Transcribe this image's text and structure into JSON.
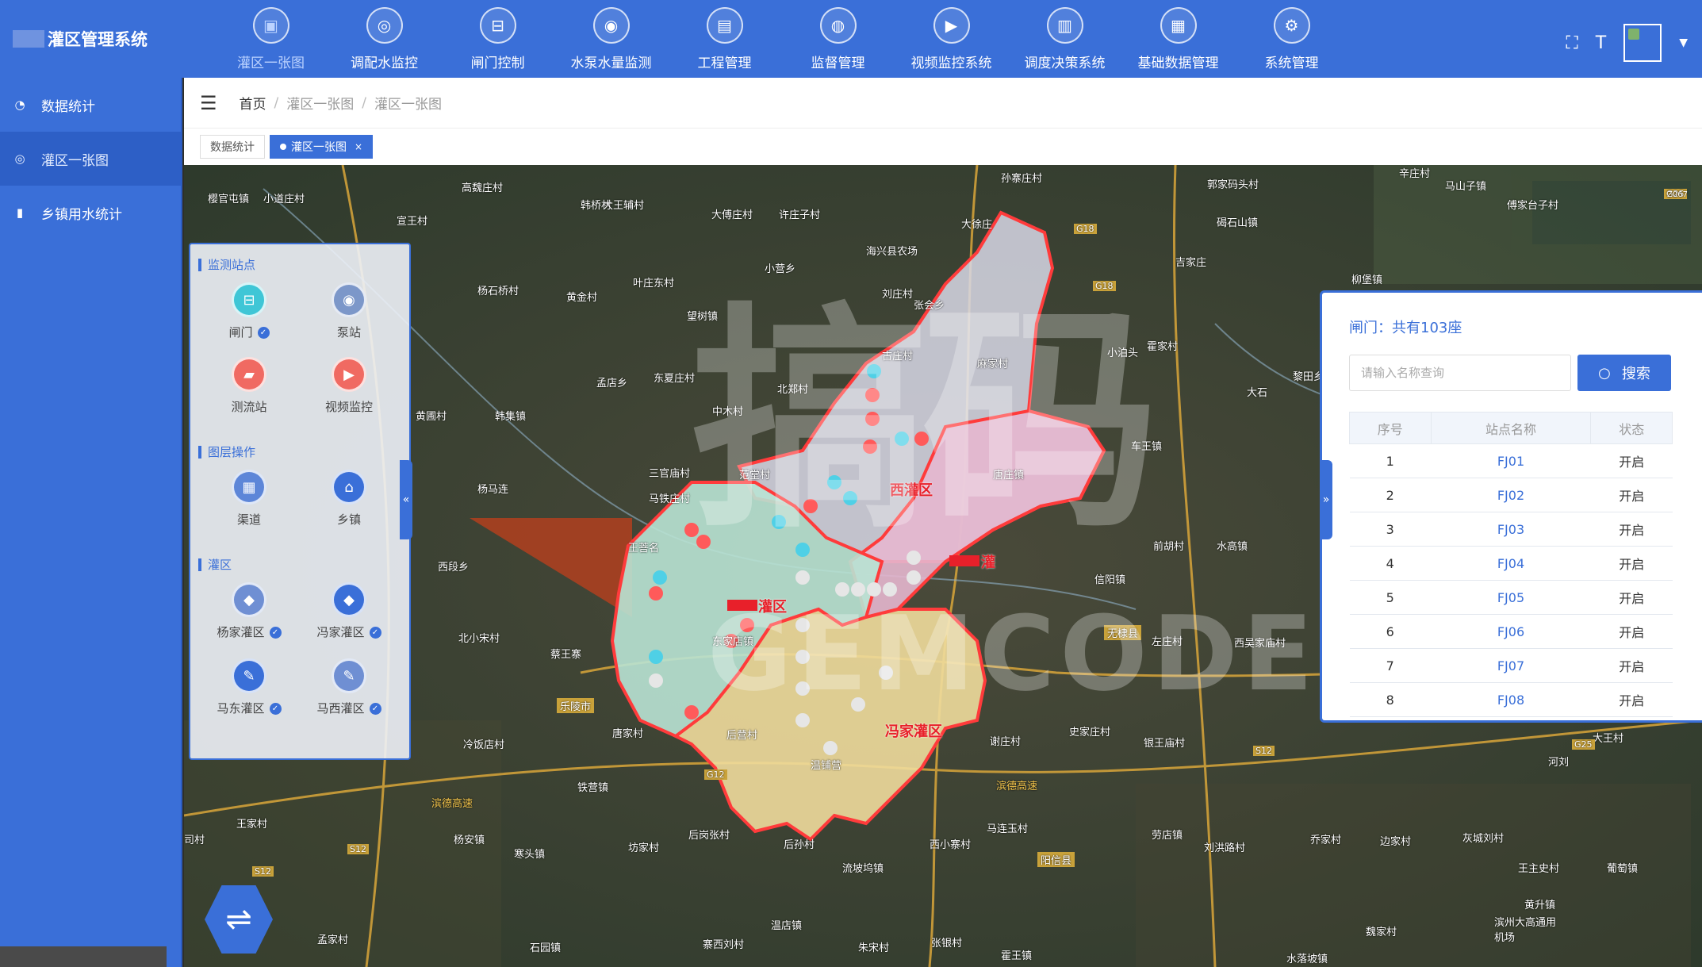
{
  "app": {
    "title": "灌区管理系统"
  },
  "nav": [
    {
      "label": "灌区一张图",
      "icon": "map-icon"
    },
    {
      "label": "调配水监控",
      "icon": "monitor-icon"
    },
    {
      "label": "闸门控制",
      "icon": "gate-icon"
    },
    {
      "label": "水泵水量监测",
      "icon": "pump-icon"
    },
    {
      "label": "工程管理",
      "icon": "project-icon"
    },
    {
      "label": "监督管理",
      "icon": "eye-icon"
    },
    {
      "label": "视频监控系统",
      "icon": "video-icon"
    },
    {
      "label": "调度决策系统",
      "icon": "chart-icon"
    },
    {
      "label": "基础数据管理",
      "icon": "database-icon"
    },
    {
      "label": "系统管理",
      "icon": "gear-icon"
    }
  ],
  "sidebar": {
    "items": [
      {
        "label": "数据统计",
        "icon": "dashboard-icon"
      },
      {
        "label": "灌区一张图",
        "icon": "target-icon"
      },
      {
        "label": "乡镇用水统计",
        "icon": "bar-chart-icon"
      }
    ]
  },
  "breadcrumb": {
    "home": "首页",
    "level1": "灌区一张图",
    "level2": "灌区一张图"
  },
  "tabs": {
    "stats": "数据统计",
    "map": "灌区一张图",
    "close": "×"
  },
  "layers": {
    "monitor_title": "监测站点",
    "gate": "闸门",
    "pump": "泵站",
    "flow": "测流站",
    "video": "视频监控",
    "ops_title": "图层操作",
    "canal": "渠道",
    "town": "乡镇",
    "zone_title": "灌区",
    "yang": "杨家灌区",
    "feng": "冯家灌区",
    "madong": "马东灌区",
    "maxi": "马西灌区",
    "check": "✓"
  },
  "gate_panel": {
    "title": "闸门：共有103座",
    "search_placeholder": "请输入名称查询",
    "search_label": "搜索",
    "columns": [
      "序号",
      "站点名称",
      "状态"
    ],
    "rows": [
      {
        "no": "1",
        "name": "FJ01",
        "status": "开启"
      },
      {
        "no": "2",
        "name": "FJ02",
        "status": "开启"
      },
      {
        "no": "3",
        "name": "FJ03",
        "status": "开启"
      },
      {
        "no": "4",
        "name": "FJ04",
        "status": "开启"
      },
      {
        "no": "5",
        "name": "FJ05",
        "status": "开启"
      },
      {
        "no": "6",
        "name": "FJ06",
        "status": "开启"
      },
      {
        "no": "7",
        "name": "FJ07",
        "status": "开启"
      },
      {
        "no": "8",
        "name": "FJ08",
        "status": "开启"
      }
    ]
  },
  "map": {
    "regions": {
      "west": "灌区",
      "north": "西灌区",
      "east": "灌",
      "south": "冯家灌区"
    },
    "places": {
      "p1": "孙寨庄村",
      "p2": "辛庄村",
      "p3": "郭家码头村",
      "p4": "马山子镇",
      "p5": "傅家台子村",
      "p6": "高魏庄村",
      "p7": "韩桥村",
      "p8": "大王辅村",
      "p9": "大傅庄村",
      "p10": "许庄子村",
      "p11": "大徐庄",
      "p12": "碣石山镇",
      "p13": "小营乡",
      "p14": "海兴县农场",
      "p15": "吉家庄",
      "p16": "柳堡镇",
      "p17": "杨石桥村",
      "p18": "黄金村",
      "p19": "叶庄东村",
      "p20": "望树镇",
      "p21": "刘庄村",
      "p22": "孟店乡",
      "p23": "东夏庄村",
      "p24": "北郑村",
      "p25": "中木村",
      "p26": "黄圃村",
      "p27": "韩集镇",
      "p28": "三官庙村",
      "p29": "范堂村",
      "p30": "马铁庄村",
      "p31": "杨马连",
      "p32": "王菩名",
      "p33": "西段乡",
      "p34": "北小宋村",
      "p35": "蔡王寨",
      "p36": "乐陵市",
      "p37": "唐家村",
      "p38": "冷饭店村",
      "p39": "铁营镇",
      "p40": "杨安镇",
      "p41": "寒头镇",
      "p42": "坊家村",
      "p43": "后岗张村",
      "p44": "后孙村",
      "p45": "流坡坞镇",
      "p46": "西小寨村",
      "p47": "马连玉村",
      "p48": "阳信县",
      "p49": "劳店镇",
      "p50": "刘洪路村",
      "p51": "乔家村",
      "p52": "边家村",
      "p53": "灰城刘村",
      "p54": "大王村",
      "p55": "河刘",
      "p56": "王主史村",
      "p57": "葡萄镇",
      "p58": "黄升镇",
      "p59": "滨州大高通用机场",
      "p60": "水落坡镇",
      "p61": "魏家村",
      "p62": "温店镇",
      "p63": "朱宋村",
      "p64": "张银村",
      "p65": "霍王镇",
      "p66": "寨西刘村",
      "p67": "石园镇",
      "p68": "孟家村",
      "p69": "司村",
      "p70": "王家村",
      "p71": "无棣县",
      "p72": "信阳镇",
      "p73": "前胡村",
      "p74": "水高镇",
      "p75": "车王镇",
      "p76": "小泊头",
      "p77": "霍家村",
      "p78": "大石",
      "p79": "黎田乡",
      "p80": "西吴家庙村",
      "p81": "史家庄村",
      "p82": "银王庙村",
      "p83": "谢庄村",
      "p84": "左庄村",
      "p85": "张会乡",
      "p86": "古庄村",
      "p87": "麻家村",
      "p88": "樱官屯镇",
      "p89": "小道庄村",
      "p90": "宣王村",
      "p91": "后营村",
      "p92": "温铺营",
      "p93": "唐庄镇",
      "p94": "东家店镇"
    },
    "roads": [
      "G18",
      "G18",
      "G25",
      "S12",
      "S12",
      "G12",
      "S12",
      "G25",
      "滨德高速",
      "滨德高速",
      "Z067"
    ]
  },
  "watermark": {
    "text1": "搞码",
    "text2": "GEMCODER"
  },
  "colors": {
    "primary": "#3a6fd8",
    "boundary": "#ff3b3b",
    "zone_west": "#b9e3d4",
    "zone_north": "#d8d8e6",
    "zone_east": "#e6b7cf",
    "zone_south": "#efdc9c"
  }
}
